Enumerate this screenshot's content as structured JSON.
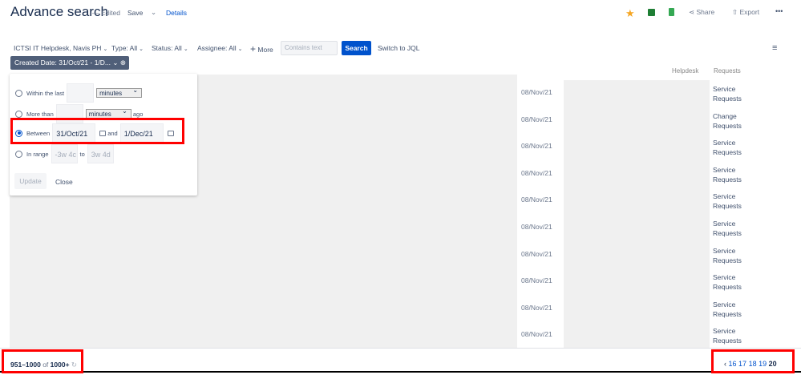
{
  "header": {
    "title": "Advance search",
    "edited": "Edited",
    "save": "Save",
    "details": "Details",
    "share": "Share",
    "export": "Export",
    "more": "•••"
  },
  "filters": {
    "project": "ICTSI IT Helpdesk, Navis PH",
    "type": "Type: All",
    "status": "Status: All",
    "assignee": "Assignee: All",
    "more": "More",
    "contains_placeholder": "Contains text",
    "search": "Search",
    "switch_jql": "Switch to JQL",
    "chip": "Created Date: 31/Oct/21 - 1/D..."
  },
  "popup": {
    "within_last": "Within the last",
    "within_unit": "minutes",
    "more_than": "More than",
    "more_unit": "minutes",
    "ago": "ago",
    "between": "Between",
    "from": "31/Oct/21",
    "and": "and",
    "to": "1/Dec/21",
    "in_range": "In range",
    "range_from": "-3w 4c",
    "to_label": "to",
    "range_to": "3w 4d",
    "update": "Update",
    "close": "Close"
  },
  "top_partial": {
    "col1": "Helpdesk",
    "col2": "Requests"
  },
  "rows": [
    {
      "date": "08/Nov/21",
      "type": "Service Requests"
    },
    {
      "date": "08/Nov/21",
      "type": "Change Requests"
    },
    {
      "date": "08/Nov/21",
      "type": "Service Requests"
    },
    {
      "date": "08/Nov/21",
      "type": "Service Requests"
    },
    {
      "date": "08/Nov/21",
      "type": "Service Requests"
    },
    {
      "date": "08/Nov/21",
      "type": "Service Requests"
    },
    {
      "date": "08/Nov/21",
      "type": "Service Requests"
    },
    {
      "date": "08/Nov/21",
      "type": "Service Requests"
    },
    {
      "date": "08/Nov/21",
      "type": "Service Requests"
    },
    {
      "date": "08/Nov/21",
      "type": "Service Requests"
    }
  ],
  "footer": {
    "range": "951–1000",
    "of": "of",
    "total": "1000+",
    "pages": [
      "16",
      "17",
      "18",
      "19"
    ],
    "current": "20",
    "prev": "‹"
  },
  "colors": {
    "accent": "#0052cc",
    "highlight": "#ff0000",
    "star": "#f5a623"
  }
}
